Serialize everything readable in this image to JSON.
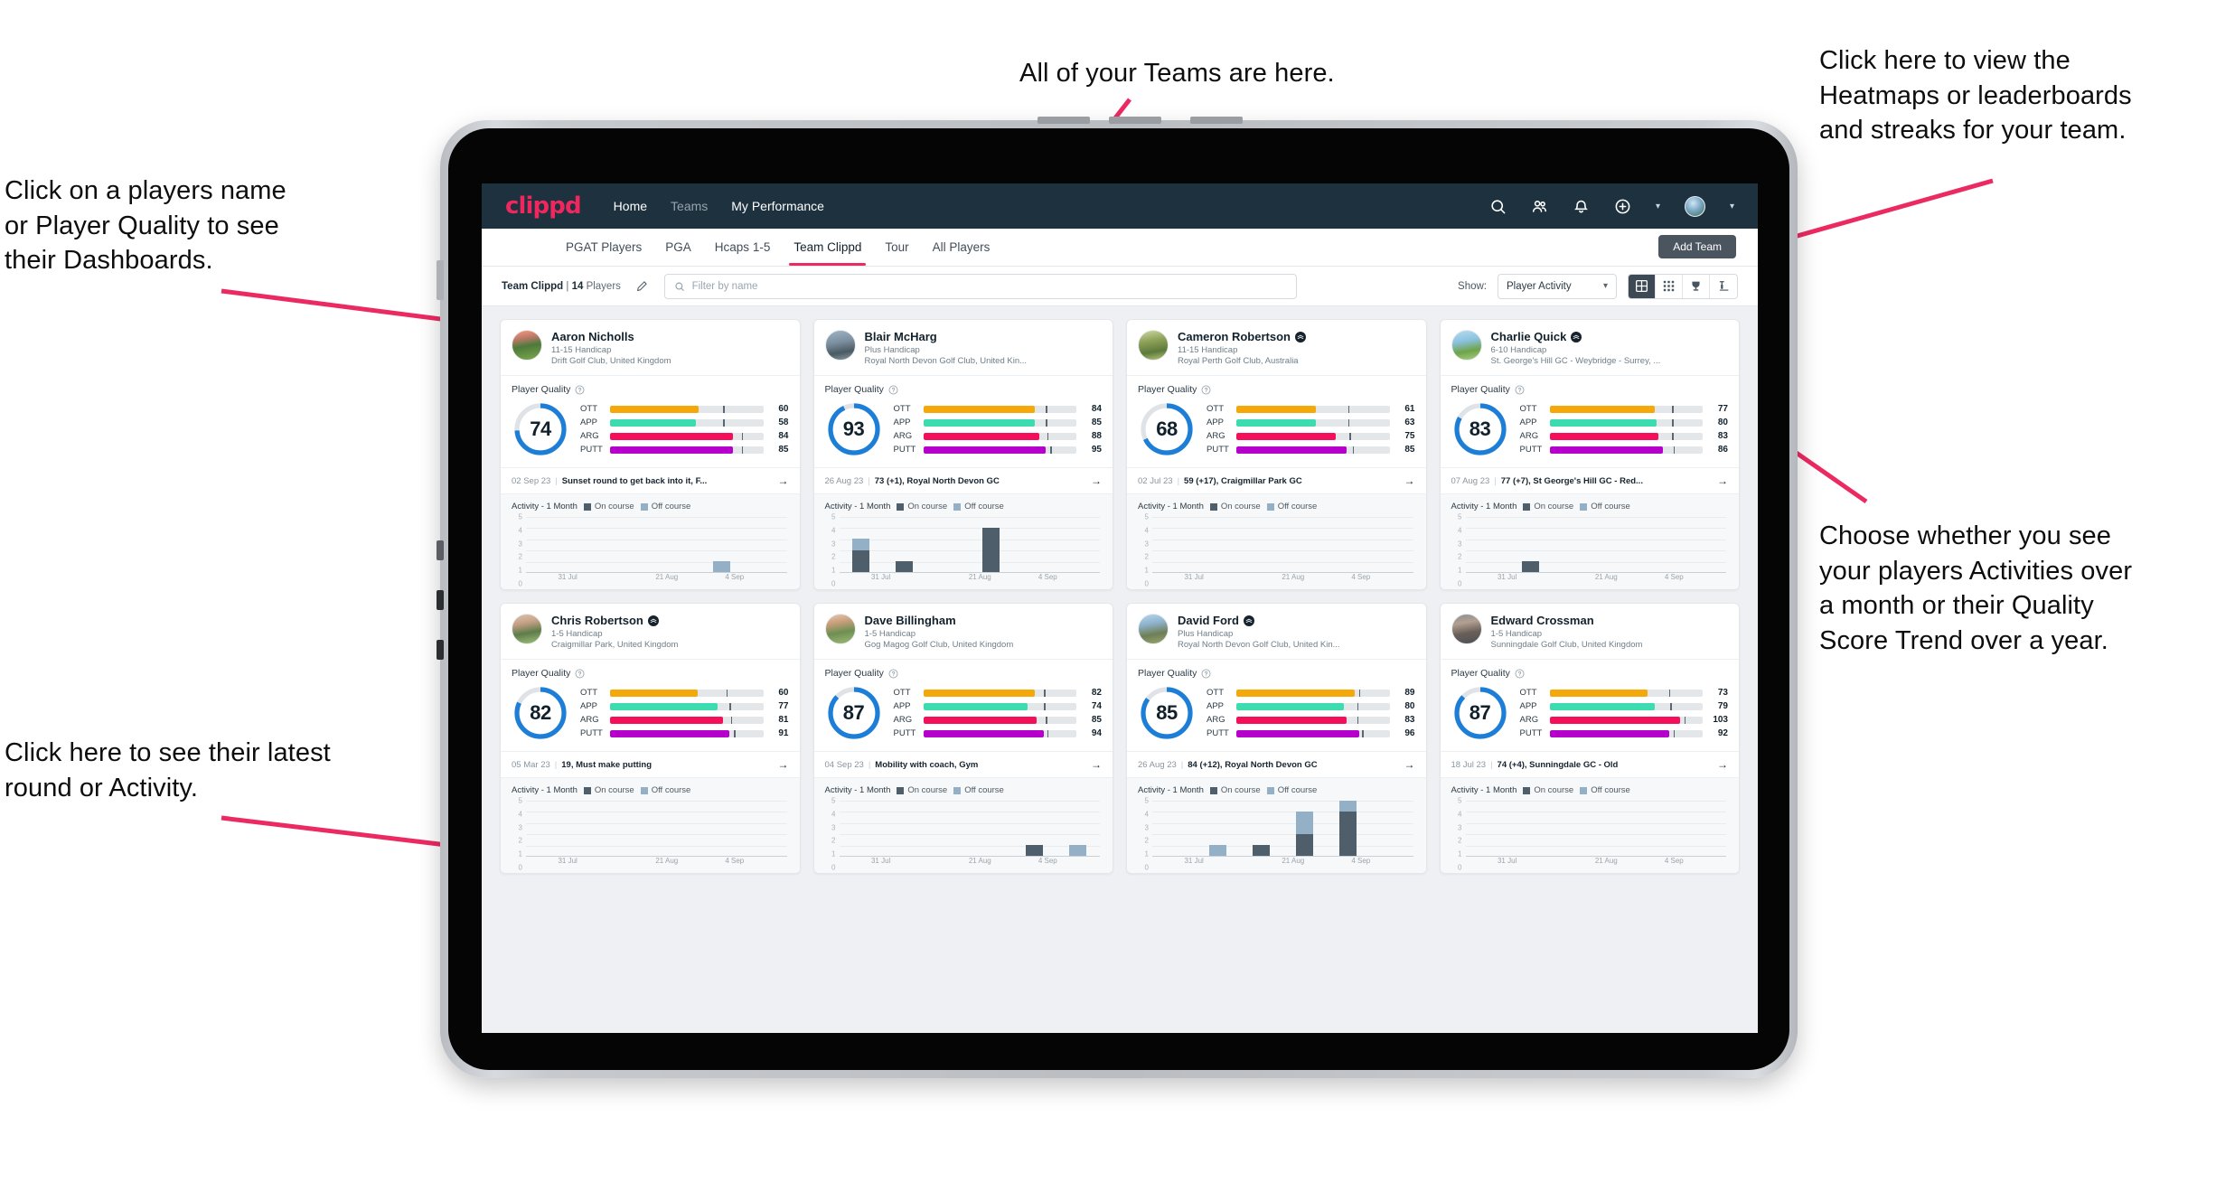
{
  "annotations": [
    {
      "id": "teams",
      "text": "All of your Teams are here."
    },
    {
      "id": "heatmaps",
      "text": "Click here to view the\nHeatmaps or leaderboards\nand streaks for your team."
    },
    {
      "id": "player-name",
      "text": "Click on a players name\nor Player Quality to see\ntheir Dashboards."
    },
    {
      "id": "activity-toggle",
      "text": "Choose whether you see\nyour players Activities over\na month or their Quality\nScore Trend over a year."
    },
    {
      "id": "latest-round",
      "text": "Click here to see their latest\nround or Activity."
    }
  ],
  "app": {
    "logo": "clippd",
    "nav": [
      {
        "label": "Home",
        "active": true
      },
      {
        "label": "Teams",
        "active": false
      },
      {
        "label": "My Performance",
        "active": true
      }
    ],
    "header_icons": [
      "search-icon",
      "people-icon",
      "bell-icon",
      "plus-circle-icon",
      "avatar"
    ],
    "tabs": [
      {
        "label": "PGAT Players",
        "active": false
      },
      {
        "label": "PGA",
        "active": false
      },
      {
        "label": "Hcaps 1-5",
        "active": false
      },
      {
        "label": "Team Clippd",
        "active": true
      },
      {
        "label": "Tour",
        "active": false
      },
      {
        "label": "All Players",
        "active": false
      }
    ],
    "add_team_label": "Add Team",
    "toolbar": {
      "team_name": "Team Clippd",
      "player_count": "14",
      "players_word": "Players",
      "separator": "|",
      "edit_icon": "pencil-icon",
      "search_placeholder": "Filter by name",
      "search_value": "",
      "show_label": "Show:",
      "show_value": "Player Activity",
      "show_options": [
        "Player Activity",
        "Quality Score Trend"
      ],
      "view_buttons": [
        "card-view-icon",
        "grid-view-icon",
        "trophy-icon",
        "streaks-icon"
      ],
      "active_view": 0
    },
    "card_labels": {
      "quality_title": "Player Quality",
      "activity_title": "Activity - 1 Month",
      "legend_on": "On course",
      "legend_off": "Off course",
      "arrow": "→"
    },
    "colors": {
      "brand_pink": "#ec2a62",
      "header_navy": "#1d313f",
      "ring_blue": "#1c7ed6",
      "ott": "#f5a809",
      "app": "#3ddbb0",
      "arg": "#f50f5a",
      "putt": "#b500cc",
      "on_course": "#4e5e6b",
      "off_course": "#93b0c6"
    },
    "chart_axis": {
      "y_ticks": [
        "5",
        "4",
        "3",
        "2",
        "1",
        "0"
      ],
      "x_ticks": [
        "31 Jul",
        "21 Aug",
        "4 Sep"
      ],
      "ymax": 5
    }
  },
  "players": [
    {
      "name": "Aaron Nicholls",
      "verified": false,
      "handicap": "11-15 Handicap",
      "club": "Drift Golf Club, United Kingdom",
      "quality": 74,
      "metrics": [
        {
          "label": "OTT",
          "value": 60,
          "fill": 58,
          "tick": 74
        },
        {
          "label": "APP",
          "value": 58,
          "fill": 56,
          "tick": 74
        },
        {
          "label": "ARG",
          "value": 84,
          "fill": 80,
          "tick": 86
        },
        {
          "label": "PUTT",
          "value": 85,
          "fill": 80,
          "tick": 86
        }
      ],
      "latest_date": "02 Sep 23",
      "latest_text": "Sunset round to get back into it, F...",
      "activity": [
        {
          "on": 0,
          "off": 0
        },
        {
          "on": 0,
          "off": 0
        },
        {
          "on": 0,
          "off": 0
        },
        {
          "on": 0,
          "off": 0
        },
        {
          "on": 0,
          "off": 1
        },
        {
          "on": 0,
          "off": 0
        }
      ]
    },
    {
      "name": "Blair McHarg",
      "verified": false,
      "handicap": "Plus Handicap",
      "club": "Royal North Devon Golf Club, United Kin...",
      "quality": 93,
      "metrics": [
        {
          "label": "OTT",
          "value": 84,
          "fill": 73,
          "tick": 80
        },
        {
          "label": "APP",
          "value": 85,
          "fill": 73,
          "tick": 80
        },
        {
          "label": "ARG",
          "value": 88,
          "fill": 76,
          "tick": 81
        },
        {
          "label": "PUTT",
          "value": 95,
          "fill": 80,
          "tick": 83
        }
      ],
      "latest_date": "26 Aug 23",
      "latest_text": "73 (+1), Royal North Devon GC",
      "activity": [
        {
          "on": 2,
          "off": 1
        },
        {
          "on": 1,
          "off": 0
        },
        {
          "on": 0,
          "off": 0
        },
        {
          "on": 4,
          "off": 0
        },
        {
          "on": 0,
          "off": 0
        },
        {
          "on": 0,
          "off": 0
        }
      ]
    },
    {
      "name": "Cameron Robertson",
      "verified": true,
      "handicap": "11-15 Handicap",
      "club": "Royal Perth Golf Club, Australia",
      "quality": 68,
      "metrics": [
        {
          "label": "OTT",
          "value": 61,
          "fill": 52,
          "tick": 73
        },
        {
          "label": "APP",
          "value": 63,
          "fill": 52,
          "tick": 73
        },
        {
          "label": "ARG",
          "value": 75,
          "fill": 65,
          "tick": 74
        },
        {
          "label": "PUTT",
          "value": 85,
          "fill": 72,
          "tick": 76
        }
      ],
      "latest_date": "02 Jul 23",
      "latest_text": "59 (+17), Craigmillar Park GC",
      "activity": [
        {
          "on": 0,
          "off": 0
        },
        {
          "on": 0,
          "off": 0
        },
        {
          "on": 0,
          "off": 0
        },
        {
          "on": 0,
          "off": 0
        },
        {
          "on": 0,
          "off": 0
        },
        {
          "on": 0,
          "off": 0
        }
      ]
    },
    {
      "name": "Charlie Quick",
      "verified": true,
      "handicap": "6-10 Handicap",
      "club": "St. George's Hill GC - Weybridge - Surrey, ...",
      "quality": 83,
      "metrics": [
        {
          "label": "OTT",
          "value": 77,
          "fill": 69,
          "tick": 80
        },
        {
          "label": "APP",
          "value": 80,
          "fill": 70,
          "tick": 80
        },
        {
          "label": "ARG",
          "value": 83,
          "fill": 71,
          "tick": 80
        },
        {
          "label": "PUTT",
          "value": 86,
          "fill": 74,
          "tick": 81
        }
      ],
      "latest_date": "07 Aug 23",
      "latest_text": "77 (+7), St George's Hill GC - Red...",
      "activity": [
        {
          "on": 0,
          "off": 0
        },
        {
          "on": 1,
          "off": 0
        },
        {
          "on": 0,
          "off": 0
        },
        {
          "on": 0,
          "off": 0
        },
        {
          "on": 0,
          "off": 0
        },
        {
          "on": 0,
          "off": 0
        }
      ]
    },
    {
      "name": "Chris Robertson",
      "verified": true,
      "handicap": "1-5 Handicap",
      "club": "Craigmillar Park, United Kingdom",
      "quality": 82,
      "metrics": [
        {
          "label": "OTT",
          "value": 60,
          "fill": 57,
          "tick": 76
        },
        {
          "label": "APP",
          "value": 77,
          "fill": 70,
          "tick": 78
        },
        {
          "label": "ARG",
          "value": 81,
          "fill": 74,
          "tick": 79
        },
        {
          "label": "PUTT",
          "value": 91,
          "fill": 78,
          "tick": 81
        }
      ],
      "latest_date": "05 Mar 23",
      "latest_text": "19, Must make putting",
      "activity": [
        {
          "on": 0,
          "off": 0
        },
        {
          "on": 0,
          "off": 0
        },
        {
          "on": 0,
          "off": 0
        },
        {
          "on": 0,
          "off": 0
        },
        {
          "on": 0,
          "off": 0
        },
        {
          "on": 0,
          "off": 0
        }
      ]
    },
    {
      "name": "Dave Billingham",
      "verified": false,
      "handicap": "1-5 Handicap",
      "club": "Gog Magog Golf Club, United Kingdom",
      "quality": 87,
      "metrics": [
        {
          "label": "OTT",
          "value": 82,
          "fill": 73,
          "tick": 79
        },
        {
          "label": "APP",
          "value": 74,
          "fill": 68,
          "tick": 79
        },
        {
          "label": "ARG",
          "value": 85,
          "fill": 74,
          "tick": 80
        },
        {
          "label": "PUTT",
          "value": 94,
          "fill": 79,
          "tick": 81
        }
      ],
      "latest_date": "04 Sep 23",
      "latest_text": "Mobility with coach, Gym",
      "activity": [
        {
          "on": 0,
          "off": 0
        },
        {
          "on": 0,
          "off": 0
        },
        {
          "on": 0,
          "off": 0
        },
        {
          "on": 0,
          "off": 0
        },
        {
          "on": 1,
          "off": 0
        },
        {
          "on": 0,
          "off": 1
        }
      ]
    },
    {
      "name": "David Ford",
      "verified": true,
      "handicap": "Plus Handicap",
      "club": "Royal North Devon Golf Club, United Kin...",
      "quality": 85,
      "metrics": [
        {
          "label": "OTT",
          "value": 89,
          "fill": 77,
          "tick": 80
        },
        {
          "label": "APP",
          "value": 80,
          "fill": 70,
          "tick": 79
        },
        {
          "label": "ARG",
          "value": 83,
          "fill": 72,
          "tick": 79
        },
        {
          "label": "PUTT",
          "value": 96,
          "fill": 80,
          "tick": 82
        }
      ],
      "latest_date": "26 Aug 23",
      "latest_text": "84 (+12), Royal North Devon GC",
      "activity": [
        {
          "on": 0,
          "off": 0
        },
        {
          "on": 0,
          "off": 1
        },
        {
          "on": 1,
          "off": 0
        },
        {
          "on": 2,
          "off": 2
        },
        {
          "on": 4,
          "off": 1
        },
        {
          "on": 0,
          "off": 0
        }
      ]
    },
    {
      "name": "Edward Crossman",
      "verified": false,
      "handicap": "1-5 Handicap",
      "club": "Sunningdale Golf Club, United Kingdom",
      "quality": 87,
      "metrics": [
        {
          "label": "OTT",
          "value": 73,
          "fill": 64,
          "tick": 78
        },
        {
          "label": "APP",
          "value": 79,
          "fill": 69,
          "tick": 79
        },
        {
          "label": "ARG",
          "value": 103,
          "fill": 85,
          "tick": 88
        },
        {
          "label": "PUTT",
          "value": 92,
          "fill": 78,
          "tick": 81
        }
      ],
      "latest_date": "18 Jul 23",
      "latest_text": "74 (+4), Sunningdale GC - Old",
      "activity": [
        {
          "on": 0,
          "off": 0
        },
        {
          "on": 0,
          "off": 0
        },
        {
          "on": 0,
          "off": 0
        },
        {
          "on": 0,
          "off": 0
        },
        {
          "on": 0,
          "off": 0
        },
        {
          "on": 0,
          "off": 0
        }
      ]
    }
  ]
}
